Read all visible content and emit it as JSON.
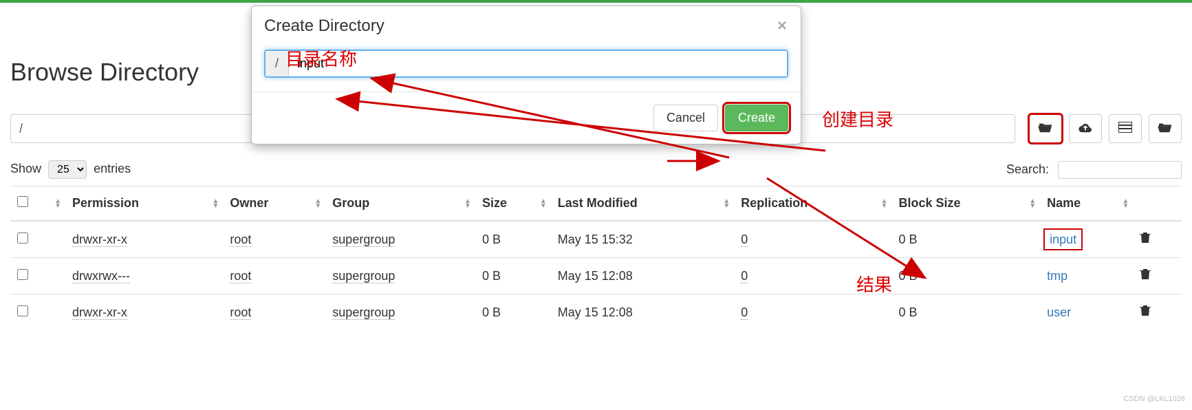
{
  "page": {
    "title": "Browse Directory",
    "path_value": "/",
    "show_label": "Show",
    "entries_label": "entries",
    "entries_count": "25",
    "search_label": "Search:"
  },
  "modal": {
    "title": "Create Directory",
    "path_prefix": "/",
    "input_value": "input",
    "cancel": "Cancel",
    "create": "Create"
  },
  "table": {
    "headers": {
      "permission": "Permission",
      "owner": "Owner",
      "group": "Group",
      "size": "Size",
      "last_modified": "Last Modified",
      "replication": "Replication",
      "block_size": "Block Size",
      "name": "Name"
    },
    "rows": [
      {
        "perm": "drwxr-xr-x",
        "owner": "root",
        "group": "supergroup",
        "size": "0 B",
        "mod": "May 15 15:32",
        "rep": "0",
        "bs": "0 B",
        "name": "input",
        "hl": true
      },
      {
        "perm": "drwxrwx---",
        "owner": "root",
        "group": "supergroup",
        "size": "0 B",
        "mod": "May 15 12:08",
        "rep": "0",
        "bs": "0 B",
        "name": "tmp",
        "hl": false
      },
      {
        "perm": "drwxr-xr-x",
        "owner": "root",
        "group": "supergroup",
        "size": "0 B",
        "mod": "May 15 12:08",
        "rep": "0",
        "bs": "0 B",
        "name": "user",
        "hl": false
      }
    ]
  },
  "annotations": {
    "dir_name": "目录名称",
    "create_dir": "创建目录",
    "result": "结果"
  },
  "watermark": "CSDN @LKL1026"
}
